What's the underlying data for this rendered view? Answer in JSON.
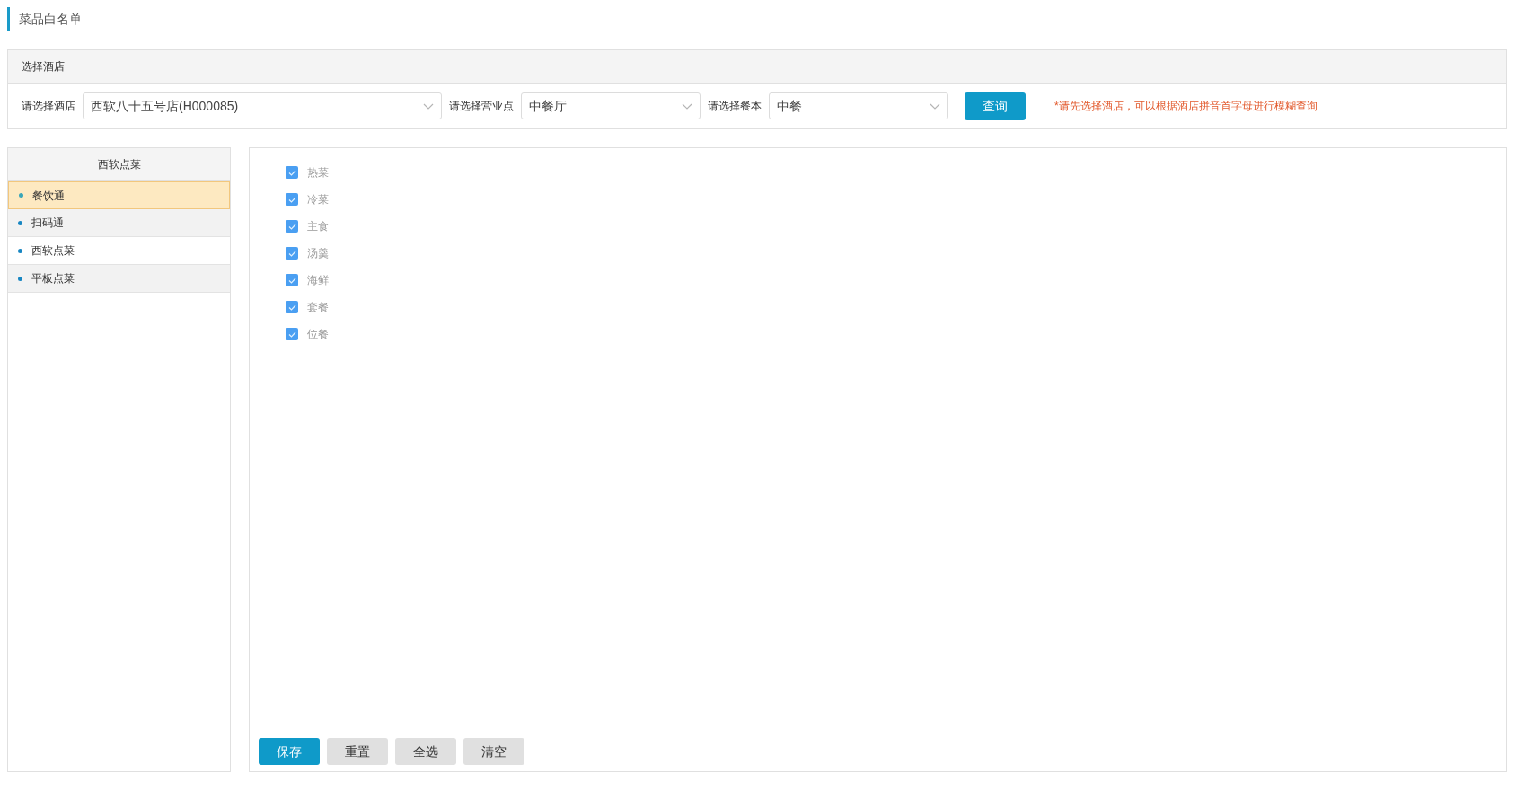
{
  "page_title": "菜品白名单",
  "filter_panel": {
    "title": "选择酒店",
    "fields": [
      {
        "label": "请选择酒店",
        "value": "西软八十五号店(H000085)"
      },
      {
        "label": "请选择营业点",
        "value": "中餐厅"
      },
      {
        "label": "请选择餐本",
        "value": "中餐"
      }
    ],
    "query_button": "查询",
    "hint": "*请先选择酒店，可以根据酒店拼音首字母进行模糊查询"
  },
  "sidebar": {
    "title": "西软点菜",
    "items": [
      {
        "label": "餐饮通",
        "selected": true
      },
      {
        "label": "扫码通",
        "selected": false
      },
      {
        "label": "西软点菜",
        "selected": false
      },
      {
        "label": "平板点菜",
        "selected": false
      }
    ]
  },
  "categories": [
    {
      "label": "热菜",
      "checked": true
    },
    {
      "label": "冷菜",
      "checked": true
    },
    {
      "label": "主食",
      "checked": true
    },
    {
      "label": "汤羹",
      "checked": true
    },
    {
      "label": "海鲜",
      "checked": true
    },
    {
      "label": "套餐",
      "checked": true
    },
    {
      "label": "位餐",
      "checked": true
    }
  ],
  "buttons": [
    {
      "label": "保存",
      "kind": "primary"
    },
    {
      "label": "重置",
      "kind": "secondary"
    },
    {
      "label": "全选",
      "kind": "secondary"
    },
    {
      "label": "清空",
      "kind": "secondary"
    }
  ]
}
